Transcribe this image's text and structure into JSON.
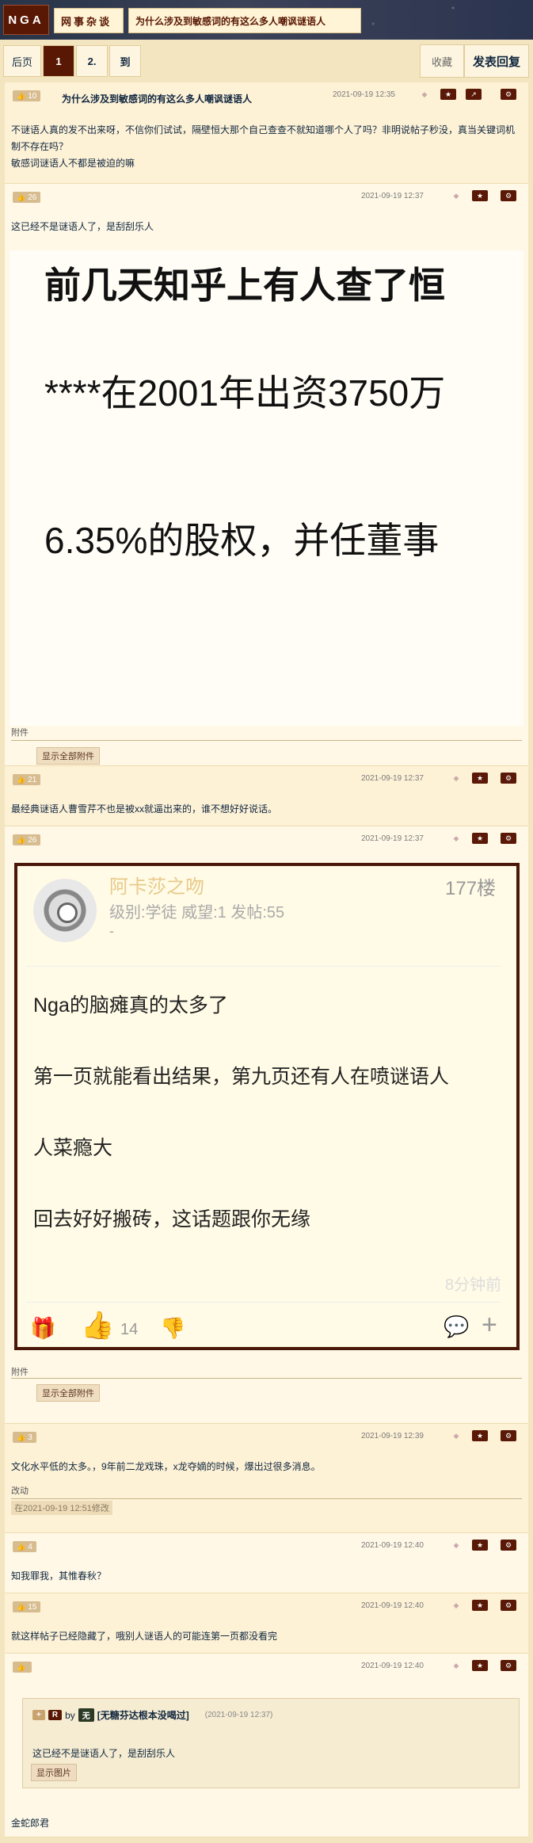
{
  "header": {
    "logo": "NGA",
    "crumb1": "网事杂谈",
    "crumb2": "为什么涉及到敏感词的有这么多人嘲讽谜语人"
  },
  "pager": {
    "prev": "后页",
    "p1": "1",
    "p2": "2.",
    "goto": "到",
    "fav": "收藏",
    "reply": "发表回复"
  },
  "posts": [
    {
      "likes": "10",
      "title": "为什么涉及到敏感词的有这么多人嘲讽谜语人",
      "time": "2021-09-19 12:35",
      "body1": "不谜语人真的发不出来呀，不信你们试试，隔壁恒大那个自己查查不就知道哪个人了吗？非明说帖子秒没，真当关键词机制不存在吗？",
      "body2": "敏感词谜语人不都是被迫的嘛"
    },
    {
      "likes": "26",
      "time": "2021-09-19 12:37",
      "body": "这已经不是谜语人了，是刮刮乐人",
      "img_line1": "前几天知乎上有人查了恒",
      "img_line2": "****在2001年出资3750万",
      "img_line3": "6.35%的股权，并任董事",
      "attach_label": "附件",
      "attach_btn": "显示全部附件"
    },
    {
      "likes": "21",
      "time": "2021-09-19 12:37",
      "body": "最经典谜语人曹雪芹不也是被xx就逼出来的，谁不想好好说话。"
    },
    {
      "likes": "26",
      "time": "2021-09-19 12:37",
      "card_user": "阿卡莎之吻",
      "card_floor": "177楼",
      "card_meta": "级别:学徒 威望:1 发帖:55",
      "card_dash": "-",
      "card_l1": "Nga的脑瘫真的太多了",
      "card_l2": "第一页就能看出结果，第九页还有人在喷谜语人",
      "card_l3": "人菜瘾大",
      "card_l4": "回去好好搬砖，这话题跟你无缘",
      "card_ago": "8分钟前",
      "card_likes": "14",
      "attach_label": "附件",
      "attach_btn": "显示全部附件"
    },
    {
      "likes": "3",
      "time": "2021-09-19 12:39",
      "body": "文化水平低的太多。，9年前二龙戏珠，x龙夺嫡的时候，爆出过很多消息。",
      "edit_label": "改动",
      "edit_note": "在2021-09-19 12:51修改"
    },
    {
      "likes": "4",
      "time": "2021-09-19 12:40",
      "body": "知我罪我，其惟春秋？"
    },
    {
      "likes": "15",
      "time": "2021-09-19 12:40",
      "body": "就这样帖子已经隐藏了，哦别人谜语人的可能连第一页都没看完"
    },
    {
      "likes": "",
      "time": "2021-09-19 12:40",
      "quote_by": "by",
      "quote_user": "[无糖芬达根本没喝过]",
      "quote_time": "(2021-09-19 12:37)",
      "quote_body": "这已经不是谜语人了，是刮刮乐人",
      "quote_btn": "显示图片",
      "body": "金蛇郎君"
    }
  ]
}
